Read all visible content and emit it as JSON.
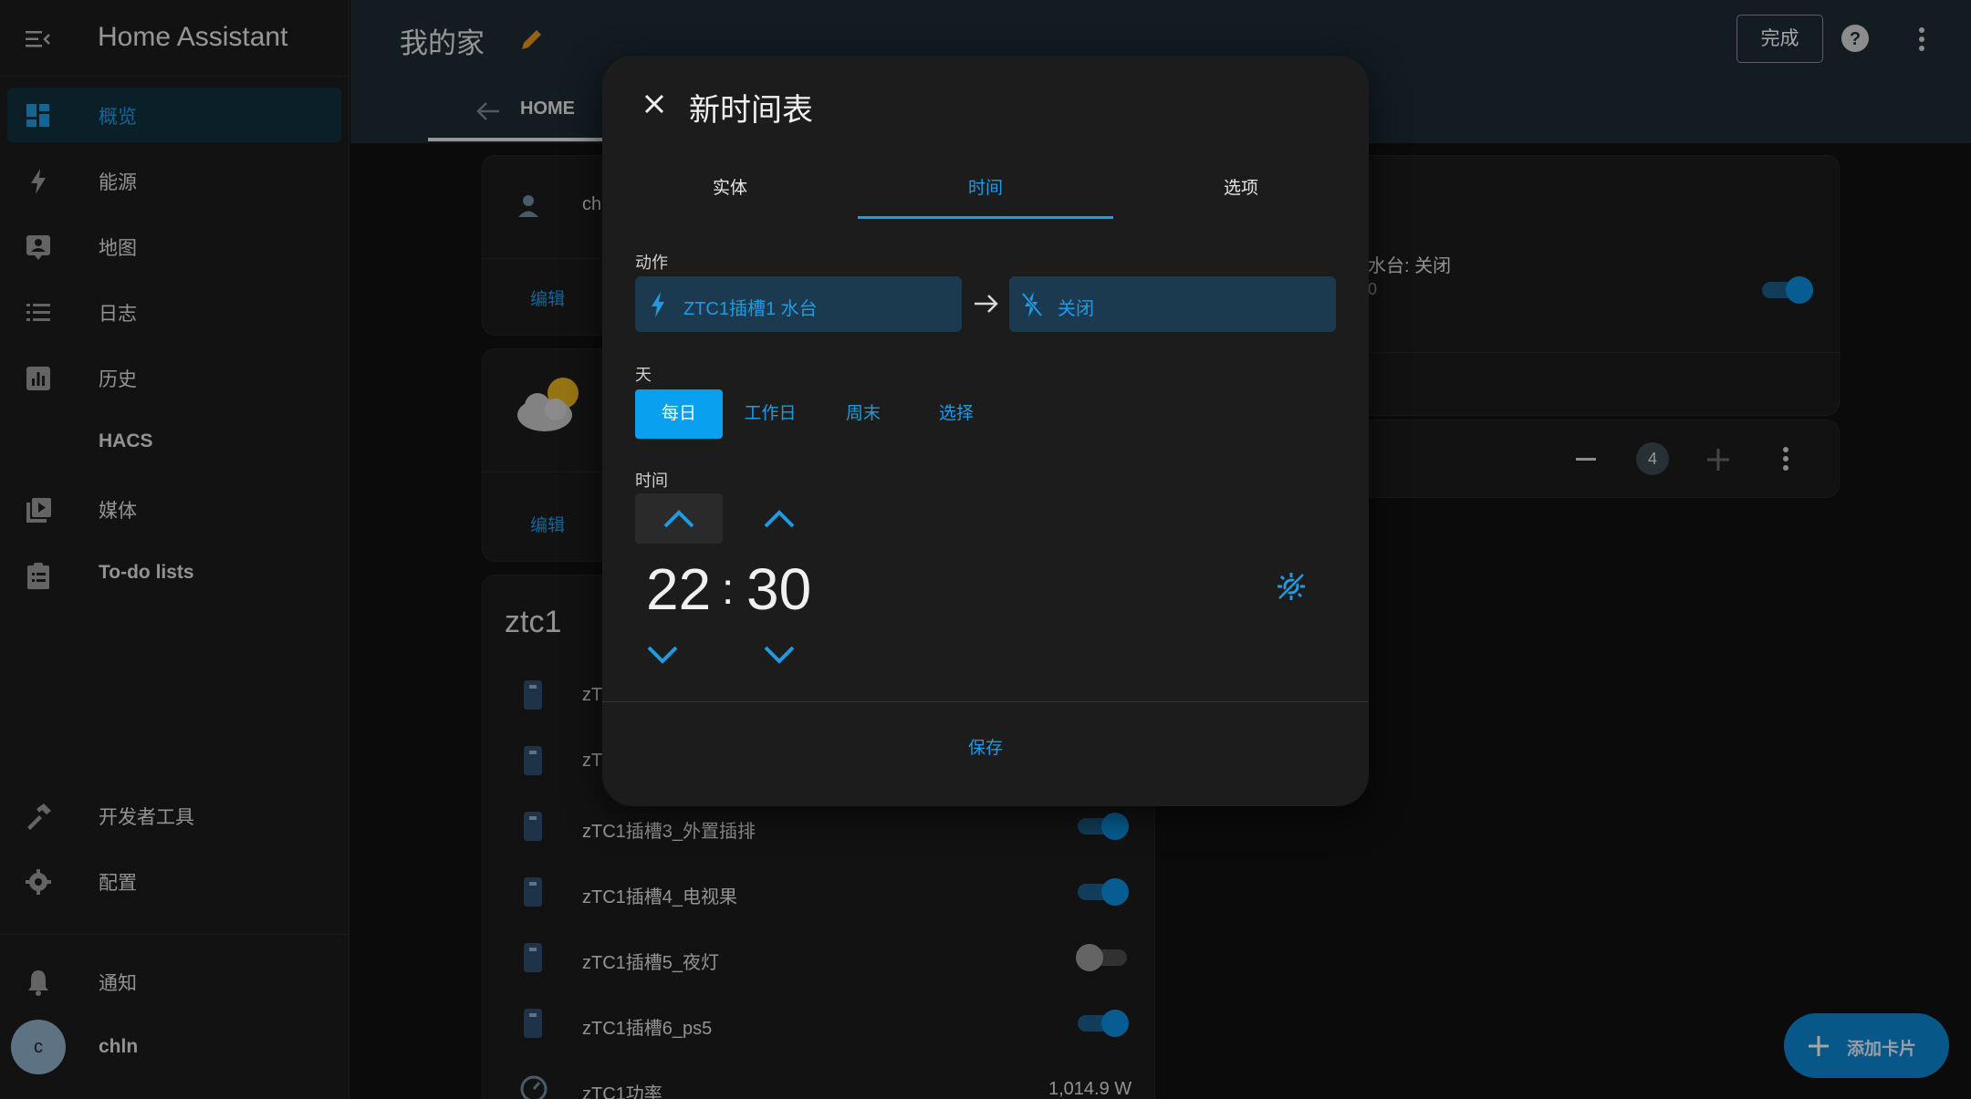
{
  "sidebar": {
    "app_title": "Home Assistant",
    "items": [
      {
        "label": "概览"
      },
      {
        "label": "能源"
      },
      {
        "label": "地图"
      },
      {
        "label": "日志"
      },
      {
        "label": "历史"
      },
      {
        "label": "HACS"
      },
      {
        "label": "媒体"
      },
      {
        "label": "To-do lists"
      },
      {
        "label": "开发者工具"
      },
      {
        "label": "配置"
      },
      {
        "label": "通知"
      }
    ],
    "user": {
      "initial": "c",
      "name": "chln"
    }
  },
  "header": {
    "title": "我的家",
    "done_label": "完成",
    "tab_home": "HOME"
  },
  "background": {
    "person_card": {
      "name_partial": "ch",
      "edit_label": "编辑"
    },
    "weather_card": {
      "edit_label": "编辑"
    },
    "right_card": {
      "status_text": "水台: 关闭",
      "status_sub": "0",
      "count_badge": "4"
    },
    "ztc1_card": {
      "title": "ztc1",
      "rows": [
        {
          "label": "zT"
        },
        {
          "label": "zT"
        },
        {
          "label": "zTC1插槽3_外置插排",
          "state": "on"
        },
        {
          "label": "zTC1插槽4_电视果",
          "state": "on"
        },
        {
          "label": "zTC1插槽5_夜灯",
          "state": "off"
        },
        {
          "label": "zTC1插槽6_ps5",
          "state": "on"
        },
        {
          "label": "zTC1功率",
          "value": "1,014.9 W"
        }
      ]
    }
  },
  "dialog": {
    "title": "新时间表",
    "tabs": [
      {
        "label": "实体"
      },
      {
        "label": "时间"
      },
      {
        "label": "选项"
      }
    ],
    "action_label": "动作",
    "action_entity": "ZTC1插槽1 水台",
    "action_target": "关闭",
    "days_label": "天",
    "day_options": [
      {
        "label": "每日"
      },
      {
        "label": "工作日"
      },
      {
        "label": "周末"
      },
      {
        "label": "选择"
      }
    ],
    "time_label": "时间",
    "hour": "22",
    "separator": ":",
    "minute": "30",
    "save_label": "保存"
  },
  "fab": {
    "label": "添加卡片"
  },
  "colors": {
    "accent": "#1e9be3",
    "header": "#1d2b33",
    "sidebar": "#1c1c1c",
    "fab": "#0c86d1"
  }
}
